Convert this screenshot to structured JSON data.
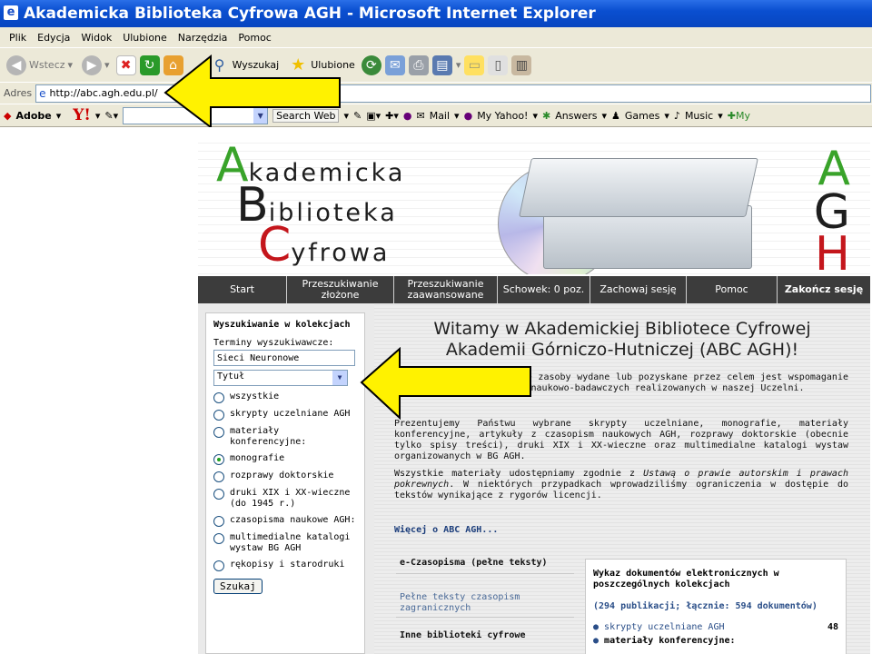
{
  "window": {
    "title": "Akademicka Biblioteka Cyfrowa AGH - Microsoft Internet Explorer"
  },
  "menu": [
    "Plik",
    "Edycja",
    "Widok",
    "Ulubione",
    "Narzędzia",
    "Pomoc"
  ],
  "toolbar": {
    "back": "Wstecz",
    "search": "Wyszukaj",
    "favorites": "Ulubione"
  },
  "address": {
    "label": "Adres",
    "url": "http://abc.agh.edu.pl/"
  },
  "yahoo_bar": {
    "adobe": "Adobe",
    "search_web": "Search Web",
    "mail": "Mail",
    "my_yahoo": "My Yahoo!",
    "answers": "Answers",
    "games": "Games",
    "music": "Music"
  },
  "site": {
    "logo": {
      "line1_cap": "A",
      "line1_rest": "kademicka",
      "line2_cap": "B",
      "line2_rest": "iblioteka",
      "line3_cap": "C",
      "line3_rest": "yfrowa",
      "agh": [
        "A",
        "G",
        "H"
      ]
    },
    "nav": [
      "Start",
      "Przeszukiwanie złożone",
      "Przeszukiwanie zaawansowane",
      "Schowek: 0 poz.",
      "Zachowaj sesję",
      "Pomoc",
      "Zakończ sesję"
    ],
    "search": {
      "title": "Wyszukiwanie w kolekcjach",
      "terms_label": "Terminy wyszukiwawcze:",
      "terms_value": "Sieci Neuronowe",
      "field": "Tytuł",
      "options": [
        "wszystkie",
        "skrypty uczelniane AGH",
        "materiały konferencyjne:",
        "monografie",
        "rozprawy doktorskie",
        "druki XIX i XX-wieczne (do 1945 r.)",
        "czasopisma naukowe AGH:",
        "multimedialne katalogi wystaw BG AGH",
        "rękopisy i starodruki"
      ],
      "selected": 3,
      "submit": "Szukaj"
    },
    "welcome": {
      "title_l1": "Witamy w Akademickiej Bibliotece Cyfrowej",
      "title_l2": "Akademii Górniczo-Hutniczej (ABC AGH)!",
      "p1": "ci Internet elektroniczne zasoby wydane lub pozyskane przez celem jest wspomaganie procesów dydaktycznych i naukowo-badawczych realizowanych w naszej Uczelni.",
      "p2": "Prezentujemy Państwu wybrane skrypty uczelniane, monografie, materiały konferencyjne, artykuły z czasopism naukowych AGH, rozprawy doktorskie (obecnie tylko spisy treści), druki XIX i XX-wieczne oraz multimedialne katalogi wystaw organizowanych w BG AGH.",
      "p3a": "Wszystkie materiały udostępniamy zgodnie z ",
      "p3i": "Ustawą o prawie autorskim i prawach pokrewnych",
      "p3b": ". W niektórych przypadkach wprowadziliśmy ograniczenia w dostępie do tekstów wynikające z rygorów licencji.",
      "more": "Więcej o ABC AGH..."
    },
    "sections": {
      "ejournals": "e-Czasopisma (pełne teksty)",
      "fulltext": "Pełne teksty czasopism zagranicznych",
      "other": "Inne biblioteki cyfrowe"
    },
    "panel": {
      "title": "Wykaz dokumentów elektronicznych w poszczególnych kolekcjach",
      "counts": "(294 publikacji; łącznie: 594 dokumentów)",
      "items": [
        {
          "label": "skrypty uczelniane AGH",
          "count": "48"
        },
        {
          "label": "materiały konferencyjne:",
          "count": ""
        }
      ]
    }
  },
  "colors": {
    "titlebar": "#0a4fd0",
    "nav_bg": "#3c3c3c",
    "arrow_fill": "#fff200",
    "logo_accent_green": "#39a32a",
    "logo_accent_red": "#c4161c"
  }
}
